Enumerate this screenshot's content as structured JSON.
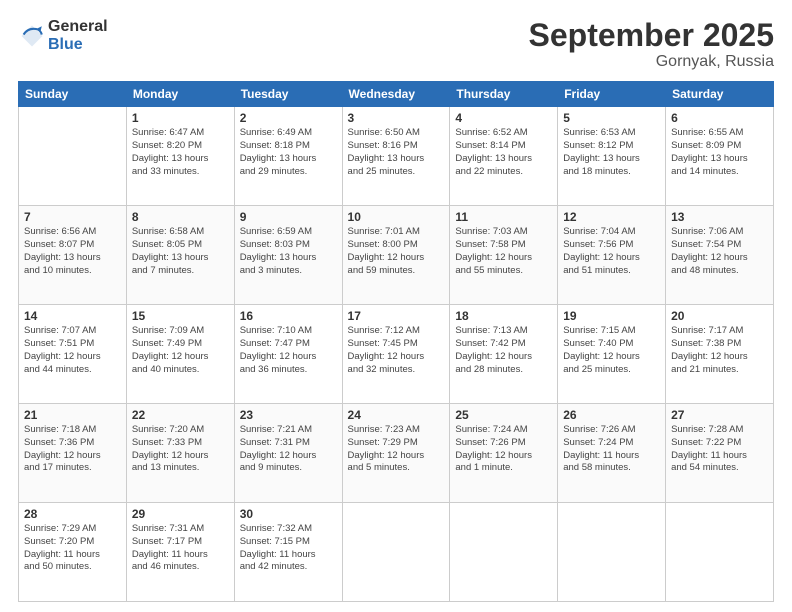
{
  "logo": {
    "general": "General",
    "blue": "Blue"
  },
  "title": "September 2025",
  "location": "Gornyak, Russia",
  "days_of_week": [
    "Sunday",
    "Monday",
    "Tuesday",
    "Wednesday",
    "Thursday",
    "Friday",
    "Saturday"
  ],
  "weeks": [
    [
      {
        "day": "",
        "info": ""
      },
      {
        "day": "1",
        "info": "Sunrise: 6:47 AM\nSunset: 8:20 PM\nDaylight: 13 hours\nand 33 minutes."
      },
      {
        "day": "2",
        "info": "Sunrise: 6:49 AM\nSunset: 8:18 PM\nDaylight: 13 hours\nand 29 minutes."
      },
      {
        "day": "3",
        "info": "Sunrise: 6:50 AM\nSunset: 8:16 PM\nDaylight: 13 hours\nand 25 minutes."
      },
      {
        "day": "4",
        "info": "Sunrise: 6:52 AM\nSunset: 8:14 PM\nDaylight: 13 hours\nand 22 minutes."
      },
      {
        "day": "5",
        "info": "Sunrise: 6:53 AM\nSunset: 8:12 PM\nDaylight: 13 hours\nand 18 minutes."
      },
      {
        "day": "6",
        "info": "Sunrise: 6:55 AM\nSunset: 8:09 PM\nDaylight: 13 hours\nand 14 minutes."
      }
    ],
    [
      {
        "day": "7",
        "info": "Sunrise: 6:56 AM\nSunset: 8:07 PM\nDaylight: 13 hours\nand 10 minutes."
      },
      {
        "day": "8",
        "info": "Sunrise: 6:58 AM\nSunset: 8:05 PM\nDaylight: 13 hours\nand 7 minutes."
      },
      {
        "day": "9",
        "info": "Sunrise: 6:59 AM\nSunset: 8:03 PM\nDaylight: 13 hours\nand 3 minutes."
      },
      {
        "day": "10",
        "info": "Sunrise: 7:01 AM\nSunset: 8:00 PM\nDaylight: 12 hours\nand 59 minutes."
      },
      {
        "day": "11",
        "info": "Sunrise: 7:03 AM\nSunset: 7:58 PM\nDaylight: 12 hours\nand 55 minutes."
      },
      {
        "day": "12",
        "info": "Sunrise: 7:04 AM\nSunset: 7:56 PM\nDaylight: 12 hours\nand 51 minutes."
      },
      {
        "day": "13",
        "info": "Sunrise: 7:06 AM\nSunset: 7:54 PM\nDaylight: 12 hours\nand 48 minutes."
      }
    ],
    [
      {
        "day": "14",
        "info": "Sunrise: 7:07 AM\nSunset: 7:51 PM\nDaylight: 12 hours\nand 44 minutes."
      },
      {
        "day": "15",
        "info": "Sunrise: 7:09 AM\nSunset: 7:49 PM\nDaylight: 12 hours\nand 40 minutes."
      },
      {
        "day": "16",
        "info": "Sunrise: 7:10 AM\nSunset: 7:47 PM\nDaylight: 12 hours\nand 36 minutes."
      },
      {
        "day": "17",
        "info": "Sunrise: 7:12 AM\nSunset: 7:45 PM\nDaylight: 12 hours\nand 32 minutes."
      },
      {
        "day": "18",
        "info": "Sunrise: 7:13 AM\nSunset: 7:42 PM\nDaylight: 12 hours\nand 28 minutes."
      },
      {
        "day": "19",
        "info": "Sunrise: 7:15 AM\nSunset: 7:40 PM\nDaylight: 12 hours\nand 25 minutes."
      },
      {
        "day": "20",
        "info": "Sunrise: 7:17 AM\nSunset: 7:38 PM\nDaylight: 12 hours\nand 21 minutes."
      }
    ],
    [
      {
        "day": "21",
        "info": "Sunrise: 7:18 AM\nSunset: 7:36 PM\nDaylight: 12 hours\nand 17 minutes."
      },
      {
        "day": "22",
        "info": "Sunrise: 7:20 AM\nSunset: 7:33 PM\nDaylight: 12 hours\nand 13 minutes."
      },
      {
        "day": "23",
        "info": "Sunrise: 7:21 AM\nSunset: 7:31 PM\nDaylight: 12 hours\nand 9 minutes."
      },
      {
        "day": "24",
        "info": "Sunrise: 7:23 AM\nSunset: 7:29 PM\nDaylight: 12 hours\nand 5 minutes."
      },
      {
        "day": "25",
        "info": "Sunrise: 7:24 AM\nSunset: 7:26 PM\nDaylight: 12 hours\nand 1 minute."
      },
      {
        "day": "26",
        "info": "Sunrise: 7:26 AM\nSunset: 7:24 PM\nDaylight: 11 hours\nand 58 minutes."
      },
      {
        "day": "27",
        "info": "Sunrise: 7:28 AM\nSunset: 7:22 PM\nDaylight: 11 hours\nand 54 minutes."
      }
    ],
    [
      {
        "day": "28",
        "info": "Sunrise: 7:29 AM\nSunset: 7:20 PM\nDaylight: 11 hours\nand 50 minutes."
      },
      {
        "day": "29",
        "info": "Sunrise: 7:31 AM\nSunset: 7:17 PM\nDaylight: 11 hours\nand 46 minutes."
      },
      {
        "day": "30",
        "info": "Sunrise: 7:32 AM\nSunset: 7:15 PM\nDaylight: 11 hours\nand 42 minutes."
      },
      {
        "day": "",
        "info": ""
      },
      {
        "day": "",
        "info": ""
      },
      {
        "day": "",
        "info": ""
      },
      {
        "day": "",
        "info": ""
      }
    ]
  ]
}
